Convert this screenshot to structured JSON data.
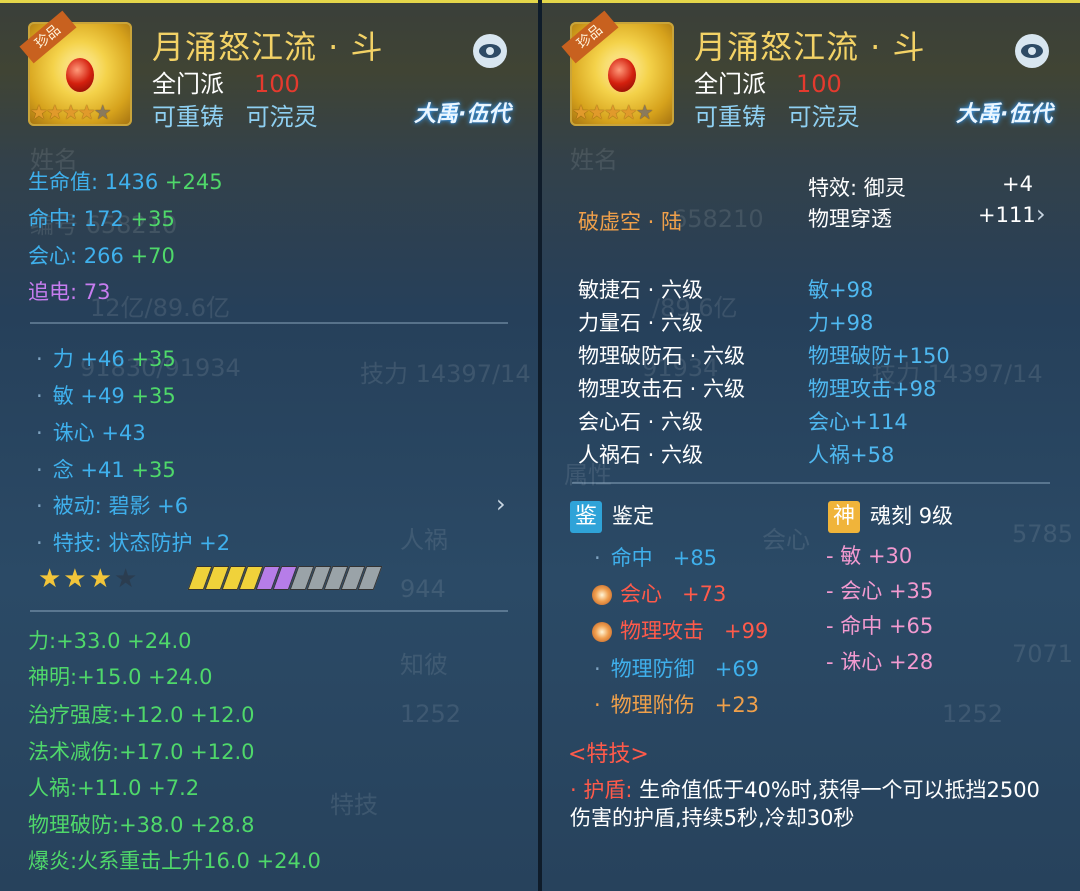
{
  "item": {
    "badge": "珍品",
    "name": "月涌怒江流 · 斗",
    "school": "全门派",
    "level": "100",
    "recast": "可重铸",
    "refine": "可浣灵",
    "brand": "大禹·伍代",
    "rarity_stars": 4
  },
  "left": {
    "base_stats": [
      {
        "name": "生命值:",
        "value": "1436",
        "bonus": "+245"
      },
      {
        "name": "命中:",
        "value": "172",
        "bonus": "+35"
      },
      {
        "name": "会心:",
        "value": "266",
        "bonus": "+70"
      }
    ],
    "special_stat": {
      "name": "追电:",
      "value": "73"
    },
    "attrs": [
      {
        "name": "力",
        "value": "+46",
        "bonus": "+35"
      },
      {
        "name": "敏",
        "value": "+49",
        "bonus": "+35"
      },
      {
        "name": "诛心",
        "value": "+43",
        "bonus": ""
      },
      {
        "name": "念",
        "value": "+41",
        "bonus": "+35"
      },
      {
        "name": "被动:",
        "value": "碧影",
        "bonus": "+6"
      },
      {
        "name": "特技:",
        "value": "状态防护",
        "bonus": "+2"
      }
    ],
    "upgrade_stars": {
      "filled": 3,
      "total": 4
    },
    "refine_bars": {
      "gold": 4,
      "violet": 2,
      "grey": 5
    },
    "green_stats": [
      {
        "name": "力:",
        "a": "+33.0",
        "b": "+24.0"
      },
      {
        "name": "神明:",
        "a": "+15.0",
        "b": "+24.0"
      },
      {
        "name": "治疗强度:",
        "a": "+12.0",
        "b": "+12.0"
      },
      {
        "name": "法术减伤:",
        "a": "+17.0",
        "b": "+12.0"
      },
      {
        "name": "人祸:",
        "a": "+11.0",
        "b": "+7.2"
      },
      {
        "name": "物理破防:",
        "a": "+38.0",
        "b": "+28.8"
      },
      {
        "name": "爆炎:",
        "a": "火系重击上升16.0",
        "b": "+24.0"
      }
    ]
  },
  "right": {
    "effects": [
      {
        "name": "特效:",
        "value": "御灵",
        "amount": "+4"
      },
      {
        "name": "物理穿透",
        "value": "",
        "amount": "+111"
      }
    ],
    "set_name": "破虚空 · 陆",
    "gems": [
      {
        "name": "敏捷石 · 六级",
        "effect": "敏+98"
      },
      {
        "name": "力量石 · 六级",
        "effect": "力+98"
      },
      {
        "name": "物理破防石 · 六级",
        "effect": "物理破防+150"
      },
      {
        "name": "物理攻击石 · 六级",
        "effect": "物理攻击+98"
      },
      {
        "name": "会心石 · 六级",
        "effect": "会心+114"
      },
      {
        "name": "人祸石 · 六级",
        "effect": "人祸+58"
      }
    ],
    "appraisal": {
      "badge": "鉴",
      "title": "鉴定",
      "items": [
        {
          "name": "命中",
          "value": "+85"
        },
        {
          "name": "会心",
          "value": "+73"
        },
        {
          "name": "物理攻击",
          "value": "+99"
        },
        {
          "name": "物理防御",
          "value": "+69"
        },
        {
          "name": "物理附伤",
          "value": "+23"
        }
      ]
    },
    "soul": {
      "badge": "神",
      "title": "魂刻",
      "level": "9级",
      "items": [
        {
          "name": "敏",
          "value": "+30"
        },
        {
          "name": "会心",
          "value": "+35"
        },
        {
          "name": "命中",
          "value": "+65"
        },
        {
          "name": "诛心",
          "value": "+28"
        }
      ]
    },
    "skill_header": "<特技>",
    "skill_name": "护盾:",
    "skill_desc": "生命值低于40%时,获得一个可以抵挡2500伤害的护盾,持续5秒,冷却30秒"
  },
  "colors": {
    "title_gold": "#f3d266",
    "level_red": "#e43a2e",
    "stat_blue": "#3fb0ec",
    "stat_green": "#4fd86a",
    "special_purple": "#c77df0",
    "set_orange": "#f0a04a",
    "soul_pink": "#f29ad0"
  },
  "icons": [
    "eye-icon",
    "chevron-right-icon",
    "star-icon",
    "gem-icon"
  ]
}
